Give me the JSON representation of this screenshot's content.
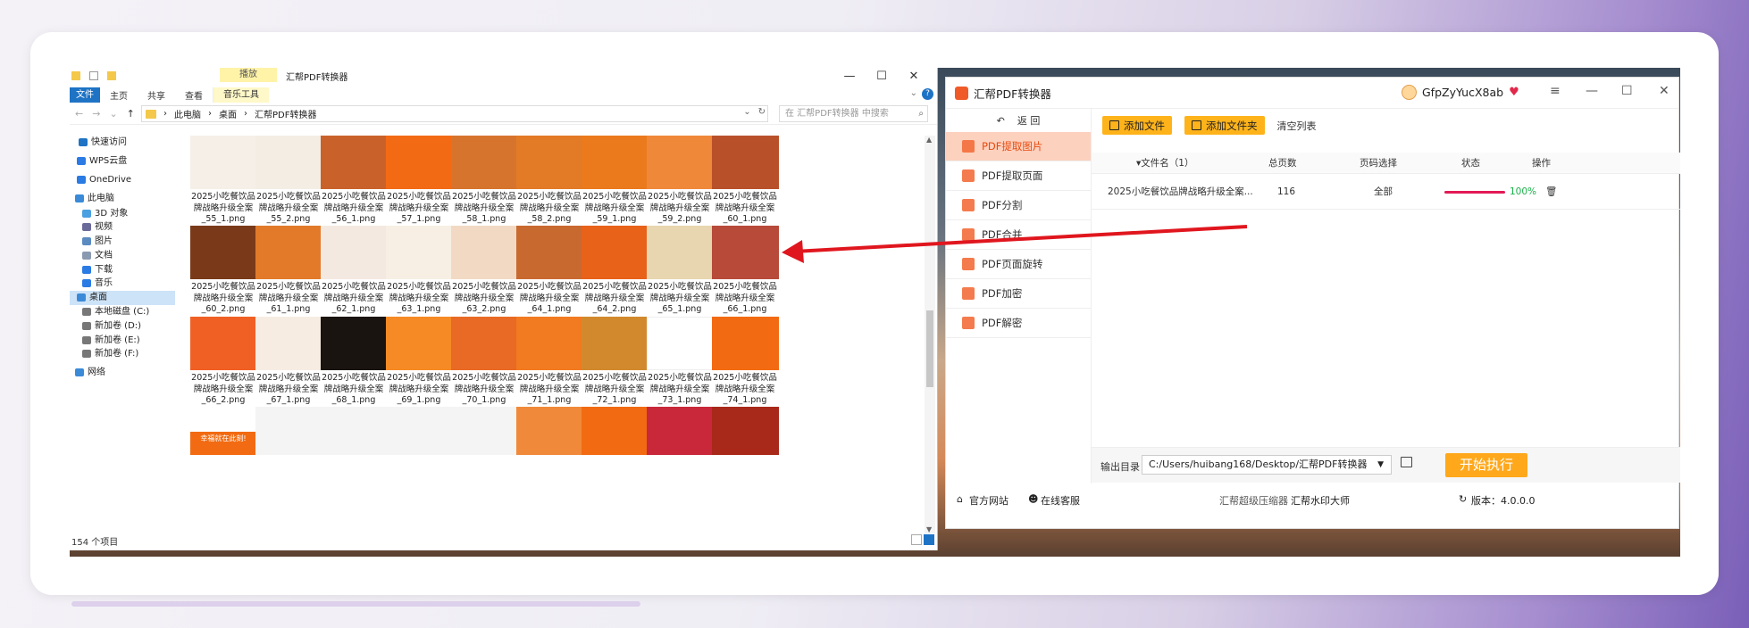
{
  "explorer": {
    "title": "汇帮PDF转换器",
    "context_tab": "播放",
    "window_controls": [
      "—",
      "☐",
      "✕"
    ],
    "ribbon_tabs": {
      "file": "文件",
      "home": "主页",
      "share": "共享",
      "view": "查看",
      "music": "音乐工具"
    },
    "ribbon_chevron": "⌄",
    "help": "?",
    "nav": {
      "back": "←",
      "forward": "→",
      "recent": "⌄",
      "up": "↑"
    },
    "breadcrumb": [
      "此电脑",
      "桌面",
      "汇帮PDF转换器"
    ],
    "path_sep": "›",
    "path_end": {
      "dropdown": "⌄",
      "refresh": "↻"
    },
    "search_placeholder": "在 汇帮PDF转换器 中搜索",
    "search_icon": "⌕",
    "sidebar": [
      {
        "label": "快速访问",
        "icon": "star-icon",
        "color": "#1e73c5"
      },
      {
        "label": "WPS云盘",
        "icon": "cloud-icon",
        "color": "#2a7be4"
      },
      {
        "label": "OneDrive",
        "icon": "cloud-icon",
        "color": "#2a7be4"
      },
      {
        "label": "此电脑",
        "icon": "computer-icon",
        "color": "#3a8ad8"
      },
      {
        "label": "3D 对象",
        "icon": "cube-icon",
        "color": "#4aa0e0"
      },
      {
        "label": "视频",
        "icon": "video-icon",
        "color": "#6a6a9a"
      },
      {
        "label": "图片",
        "icon": "image-icon",
        "color": "#5a8ac0"
      },
      {
        "label": "文档",
        "icon": "document-icon",
        "color": "#8a9ab0"
      },
      {
        "label": "下载",
        "icon": "download-icon",
        "color": "#2a7be4"
      },
      {
        "label": "音乐",
        "icon": "music-icon",
        "color": "#2a7be4"
      },
      {
        "label": "桌面",
        "icon": "desktop-icon",
        "color": "#3a8ad8",
        "selected": true
      },
      {
        "label": "本地磁盘 (C:)",
        "icon": "drive-icon",
        "color": "#777"
      },
      {
        "label": "新加卷 (D:)",
        "icon": "drive-icon",
        "color": "#777"
      },
      {
        "label": "新加卷 (E:)",
        "icon": "drive-icon",
        "color": "#777"
      },
      {
        "label": "新加卷 (F:)",
        "icon": "drive-icon",
        "color": "#777"
      },
      {
        "label": "网络",
        "icon": "network-icon",
        "color": "#3a8ad8"
      }
    ],
    "file_prefix": "2025小吃餐饮品牌战略升级全案",
    "files": [
      {
        "suffix": "_55_1.png",
        "color": "#f6efe8"
      },
      {
        "suffix": "_55_2.png",
        "color": "#f3ede4"
      },
      {
        "suffix": "_56_1.png",
        "color": "#c9622a"
      },
      {
        "suffix": "_57_1.png",
        "color": "#f36a14"
      },
      {
        "suffix": "_58_1.png",
        "color": "#d6742e"
      },
      {
        "suffix": "_58_2.png",
        "color": "#e37a26"
      },
      {
        "suffix": "_59_1.png",
        "color": "#ea7a1c"
      },
      {
        "suffix": "_59_2.png",
        "color": "#f0883a"
      },
      {
        "suffix": "_60_1.png",
        "color": "#b8512a"
      },
      {
        "suffix": "_60_2.png",
        "color": "#7a3a1a"
      },
      {
        "suffix": "_61_1.png",
        "color": "#e27a2a"
      },
      {
        "suffix": "_62_1.png",
        "color": "#f4e9e0"
      },
      {
        "suffix": "_63_1.png",
        "color": "#f7efe3"
      },
      {
        "suffix": "_63_2.png",
        "color": "#f2d9c4"
      },
      {
        "suffix": "_64_1.png",
        "color": "#c86a30"
      },
      {
        "suffix": "_64_2.png",
        "color": "#e8621a"
      },
      {
        "suffix": "_65_1.png",
        "color": "#e8d6b0"
      },
      {
        "suffix": "_66_1.png",
        "color": "#b84a3a"
      },
      {
        "suffix": "_66_2.png",
        "color": "#f06024"
      },
      {
        "suffix": "_67_1.png",
        "color": "#f7ece2"
      },
      {
        "suffix": "_68_1.png",
        "color": "#1a1410"
      },
      {
        "suffix": "_69_1.png",
        "color": "#f68a24"
      },
      {
        "suffix": "_70_1.png",
        "color": "#e86a24"
      },
      {
        "suffix": "_71_1.png",
        "color": "#f27a20"
      },
      {
        "suffix": "_72_1.png",
        "color": "#d2892e"
      },
      {
        "suffix": "_73_1.png",
        "color": "#ffffff"
      },
      {
        "suffix": "_74_1.png",
        "color": "#f26b12"
      }
    ],
    "partial_thumbs": [
      "#f26b12",
      "#f4f4f4",
      "#f4f4f4",
      "#f4f4f4",
      "#f4f4f4",
      "#f08a3a",
      "#f26b12",
      "#c8283a",
      "#a8281a"
    ],
    "partial_text": "幸福就在此刻!",
    "item_count": "154 个项目"
  },
  "app": {
    "name": "汇帮PDF转换器",
    "username": "GfpZyYucX8ab",
    "vip_icon": "♥",
    "window_buttons": {
      "menu": "≡",
      "min": "—",
      "max": "☐",
      "close": "✕"
    },
    "back": {
      "arrow": "↶",
      "label": "返 回"
    },
    "nav": [
      {
        "label": "PDF提取图片",
        "active": true
      },
      {
        "label": "PDF提取页面"
      },
      {
        "label": "PDF分割"
      },
      {
        "label": "PDF合并"
      },
      {
        "label": "PDF页面旋转"
      },
      {
        "label": "PDF加密"
      },
      {
        "label": "PDF解密"
      }
    ],
    "toolbar": {
      "add_file": "添加文件",
      "add_folder": "添加文件夹",
      "clear": "清空列表"
    },
    "table": {
      "headers": {
        "filename": "▾文件名（1）",
        "pages": "总页数",
        "page_select": "页码选择",
        "status": "状态",
        "action": "操作"
      },
      "row": {
        "filename": "2025小吃餐饮品牌战略升级全案...",
        "pages": "116",
        "page_select": "全部",
        "progress": 1.0,
        "status": "100%",
        "delete": "🗑"
      }
    },
    "output": {
      "label": "输出目录：",
      "path": "C:/Users/huibang168/Desktop/汇帮PDF转换器",
      "caret": "▼"
    },
    "start": "开始执行",
    "footer": {
      "site": "官方网站",
      "service": "在线客服",
      "compress": "汇帮超级压缩器",
      "watermark": "汇帮水印大师",
      "version": "版本：4.0.0.0"
    },
    "accent": "#ffb31a",
    "active_color": "#e74b10",
    "progress_color": "#e21a55",
    "ok_color": "#1bb14a"
  },
  "annotation": {
    "arrow_color": "#e0161e"
  }
}
